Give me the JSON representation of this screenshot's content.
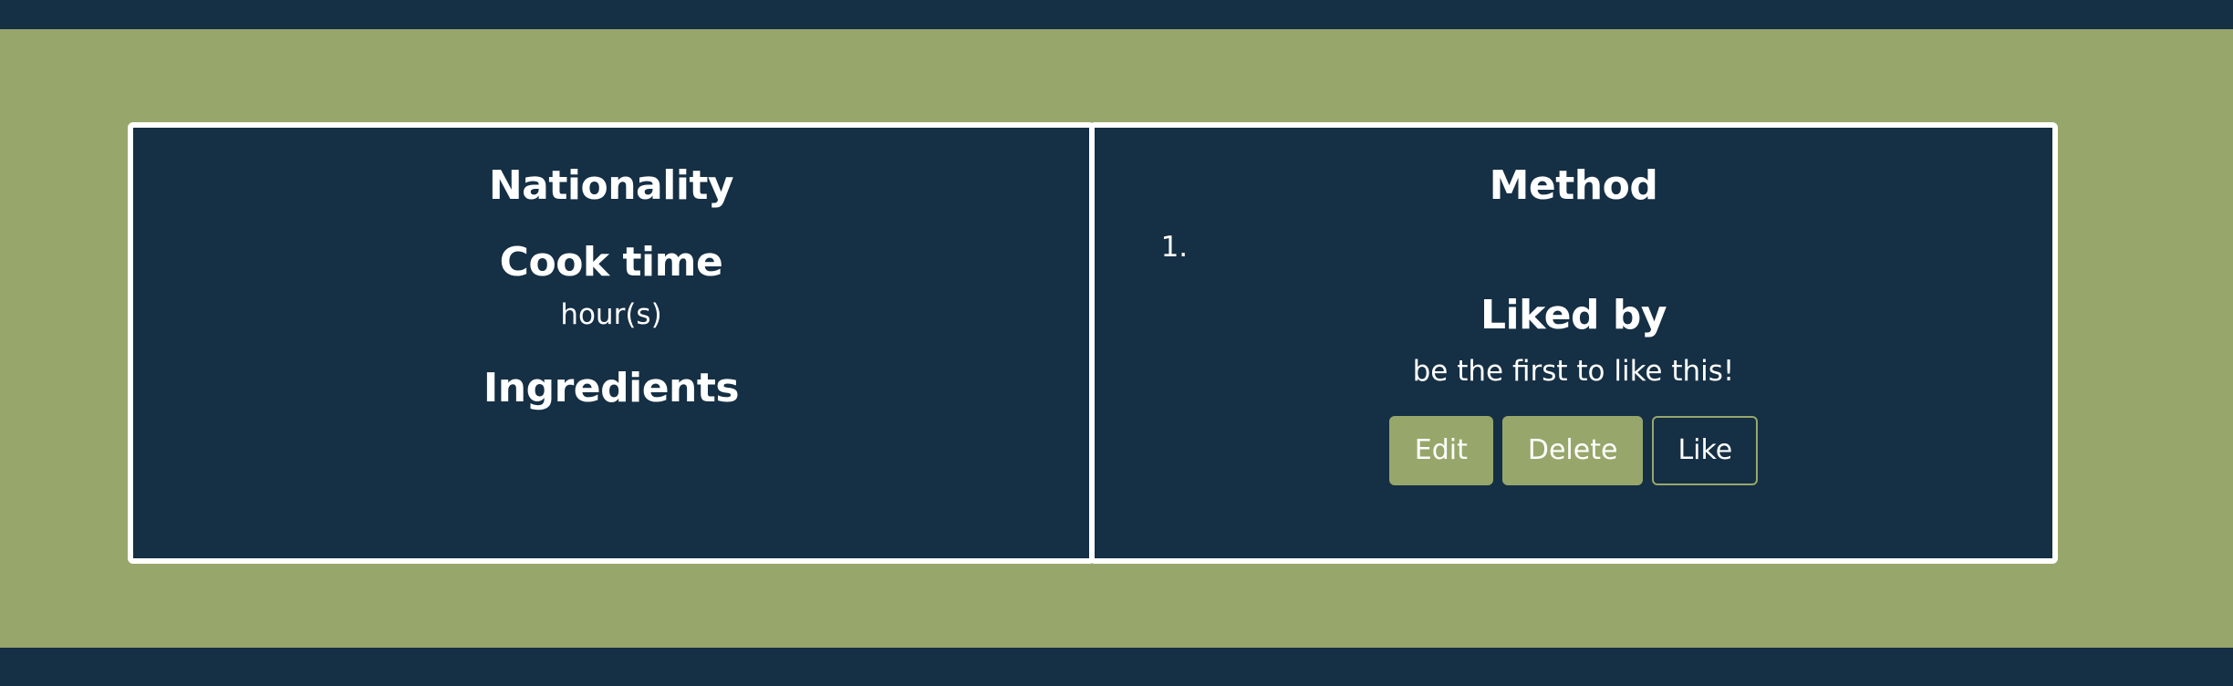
{
  "colors": {
    "navy": "#152f44",
    "olive": "#97a76b",
    "white": "#ffffff"
  },
  "details_card": {
    "nationality_heading": "Nationality",
    "cooktime_heading": "Cook time",
    "cooktime_unit": "hour(s)",
    "ingredients_heading": "Ingredients"
  },
  "method_card": {
    "method_heading": "Method",
    "steps": [
      ""
    ],
    "liked_heading": "Liked by",
    "liked_text": "be the first to like this!",
    "buttons": {
      "edit_label": "Edit",
      "delete_label": "Delete",
      "like_label": "Like"
    }
  }
}
